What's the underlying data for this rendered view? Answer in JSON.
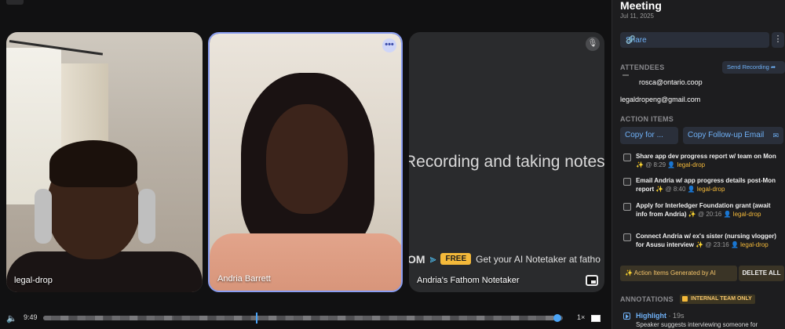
{
  "stage": {
    "tiles": [
      {
        "name": "legal-drop"
      },
      {
        "name": "Andria Barrett",
        "more_glyph": "•••"
      },
      {
        "name": "Andria's Fathom Notetaker",
        "overlay_text": "Recording and taking notes",
        "promo": {
          "brand_fragment": "OM",
          "free_badge": "FREE",
          "cta": "Get your AI Notetaker at fatho"
        }
      }
    ]
  },
  "playback": {
    "time": "9:49",
    "speed": "1×",
    "progress_fraction": 0.99,
    "marker_fraction": 0.41
  },
  "sidebar": {
    "title": "Meeting",
    "date": "Jul 11, 2025",
    "share_label": "Share",
    "kebab_glyph": "⋮",
    "attendees_heading": "ATTENDEES",
    "send_recording_label": "Send Recording ➦",
    "attendees": [
      "rosca@ontario.coop",
      "legaldropeng@gmail.com"
    ],
    "action_items_heading": "ACTION ITEMS",
    "copy_for_label": "Copy for    ...",
    "copy_followup_label": "Copy Follow-up Email",
    "action_items": [
      {
        "text": "Share app dev progress report w/ team on Mon ✨",
        "time": "@ 8:29",
        "who": "👤 legal-drop"
      },
      {
        "text": "Email Andria w/ app progress details post-Mon report ✨",
        "time": "@ 8:40",
        "who": "👤 legal-drop"
      },
      {
        "text": "Apply for Interledger Foundation grant (await info from Andria) ✨",
        "time": "@ 20:16",
        "who": "👤 legal-drop"
      },
      {
        "text": "Connect Andria w/ ex's sister (nursing vlogger) for Asusu interview ✨",
        "time": "@ 23:16",
        "who": "👤 legal-drop"
      }
    ],
    "generated_label": "✨ Action Items Generated by AI",
    "delete_all_label": "DELETE ALL",
    "annotations_heading": "ANNOTATIONS",
    "internal_badge": "INTERNAL TEAM ONLY",
    "highlight": {
      "title": "Highlight",
      "duration": " · 19s",
      "desc": "Speaker suggests interviewing someone for"
    }
  }
}
